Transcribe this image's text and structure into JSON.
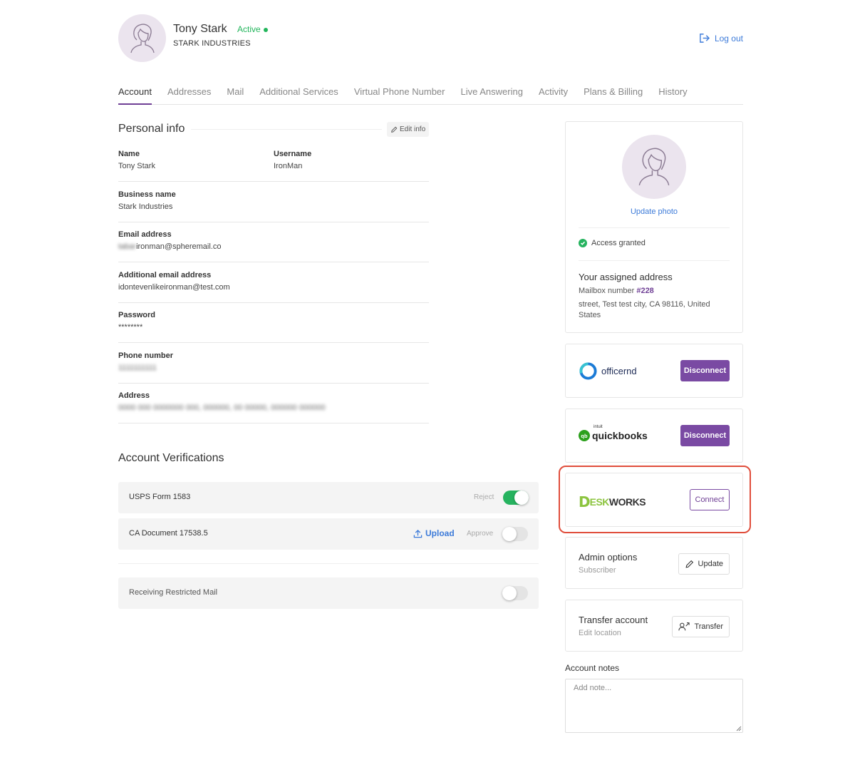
{
  "user": {
    "name": "Tony Stark",
    "status": "Active",
    "company": "STARK INDUSTRIES"
  },
  "header": {
    "logout_label": "Log out"
  },
  "tabs": [
    "Account",
    "Addresses",
    "Mail",
    "Additional Services",
    "Virtual Phone Number",
    "Live Answering",
    "Activity",
    "Plans & Billing",
    "History"
  ],
  "personal_info": {
    "title": "Personal info",
    "edit_label": "Edit info",
    "name_label": "Name",
    "name_value": "Tony Stark",
    "username_label": "Username",
    "username_value": "IronMan",
    "business_label": "Business name",
    "business_value": "Stark Industries",
    "email_label": "Email address",
    "email_value": "ironman@spheremail.co",
    "additional_email_label": "Additional email address",
    "additional_email_value": "idontevenlikeironman@test.com",
    "password_label": "Password",
    "password_value": "********",
    "phone_label": "Phone number",
    "address_label": "Address"
  },
  "verifications": {
    "title": "Account Verifications",
    "usps_label": "USPS Form 1583",
    "usps_reject": "Reject",
    "usps_on": true,
    "ca_label": "CA Document 17538.5",
    "ca_upload": "Upload",
    "ca_approve": "Approve",
    "ca_on": false,
    "restricted_label": "Receiving Restricted Mail",
    "restricted_on": false
  },
  "profile_card": {
    "update_photo": "Update photo",
    "access": "Access granted",
    "assigned_title": "Your assigned address",
    "mailbox_prefix": "Mailbox number",
    "mailbox_number": "#228",
    "address": "street, Test test city, CA 98116, United States"
  },
  "integrations": {
    "officernd": {
      "logo": "officernd",
      "button": "Disconnect"
    },
    "quickbooks": {
      "logo_small": "intuit",
      "logo": "quickbooks",
      "button": "Disconnect"
    },
    "deskworks": {
      "logo_a": "D",
      "logo_b": "ESK",
      "logo_c": "WORKS",
      "button": "Connect"
    }
  },
  "admin": {
    "title": "Admin options",
    "subtitle": "Subscriber",
    "button": "Update"
  },
  "transfer": {
    "title": "Transfer account",
    "subtitle": "Edit location",
    "button": "Transfer"
  },
  "notes": {
    "label": "Account notes",
    "placeholder": "Add note..."
  },
  "colors": {
    "accent_purple": "#7a4aa3",
    "active_green": "#22b55b",
    "link_blue": "#3d7bd9",
    "highlight_red": "#e04e3c"
  }
}
